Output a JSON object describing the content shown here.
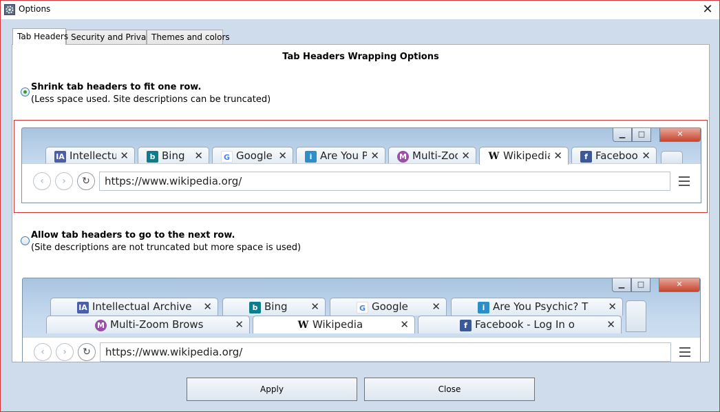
{
  "window": {
    "title": "Options",
    "close_glyph": "✕"
  },
  "tabs": [
    {
      "label": "Tab Headers",
      "active": true
    },
    {
      "label": "Security and Privacy",
      "active": false
    },
    {
      "label": "Themes and colors",
      "active": false
    }
  ],
  "section_title": "Tab Headers Wrapping Options",
  "option1": {
    "label": "Shrink tab headers to fit one row.",
    "desc": "(Less space used. Site descriptions can be truncated)",
    "selected": true
  },
  "option2": {
    "label": "Allow tab headers to go to the next row.",
    "desc": "(Site descriptions are not truncated but more space is used)",
    "selected": false
  },
  "preview1": {
    "tabs": [
      {
        "label": "Intellectual Archive",
        "icon": "IA"
      },
      {
        "label": "Bing",
        "icon": "b"
      },
      {
        "label": "Google",
        "icon": "G"
      },
      {
        "label": "Are You Psychic? T",
        "icon": "i"
      },
      {
        "label": "Multi-Zoom Brows",
        "icon": "M"
      },
      {
        "label": "Wikipedia",
        "icon": "W"
      },
      {
        "label": "Facebook",
        "icon": "f"
      }
    ],
    "url": "https://www.wikipedia.org/"
  },
  "preview2": {
    "row1": [
      {
        "label": "Intellectual Archive",
        "icon": "IA"
      },
      {
        "label": "Bing",
        "icon": "b"
      },
      {
        "label": "Google",
        "icon": "G"
      },
      {
        "label": "Are You Psychic? T",
        "icon": "i"
      }
    ],
    "row2": [
      {
        "label": "Multi-Zoom Brows",
        "icon": "M"
      },
      {
        "label": "Wikipedia",
        "icon": "W"
      },
      {
        "label": "Facebook - Log In o",
        "icon": "f"
      }
    ],
    "url": "https://www.wikipedia.org/"
  },
  "glyphs": {
    "tab_close": "✕",
    "back": "‹",
    "forward": "›",
    "reload": "↻",
    "minimize": "▁",
    "maximize": "□",
    "close": "✕"
  },
  "buttons": {
    "apply": "Apply",
    "close": "Close"
  },
  "colors": {
    "accent_border": "#d13438",
    "radio_dot": "#3a9a3a",
    "window_bg": "#cfdcec"
  }
}
